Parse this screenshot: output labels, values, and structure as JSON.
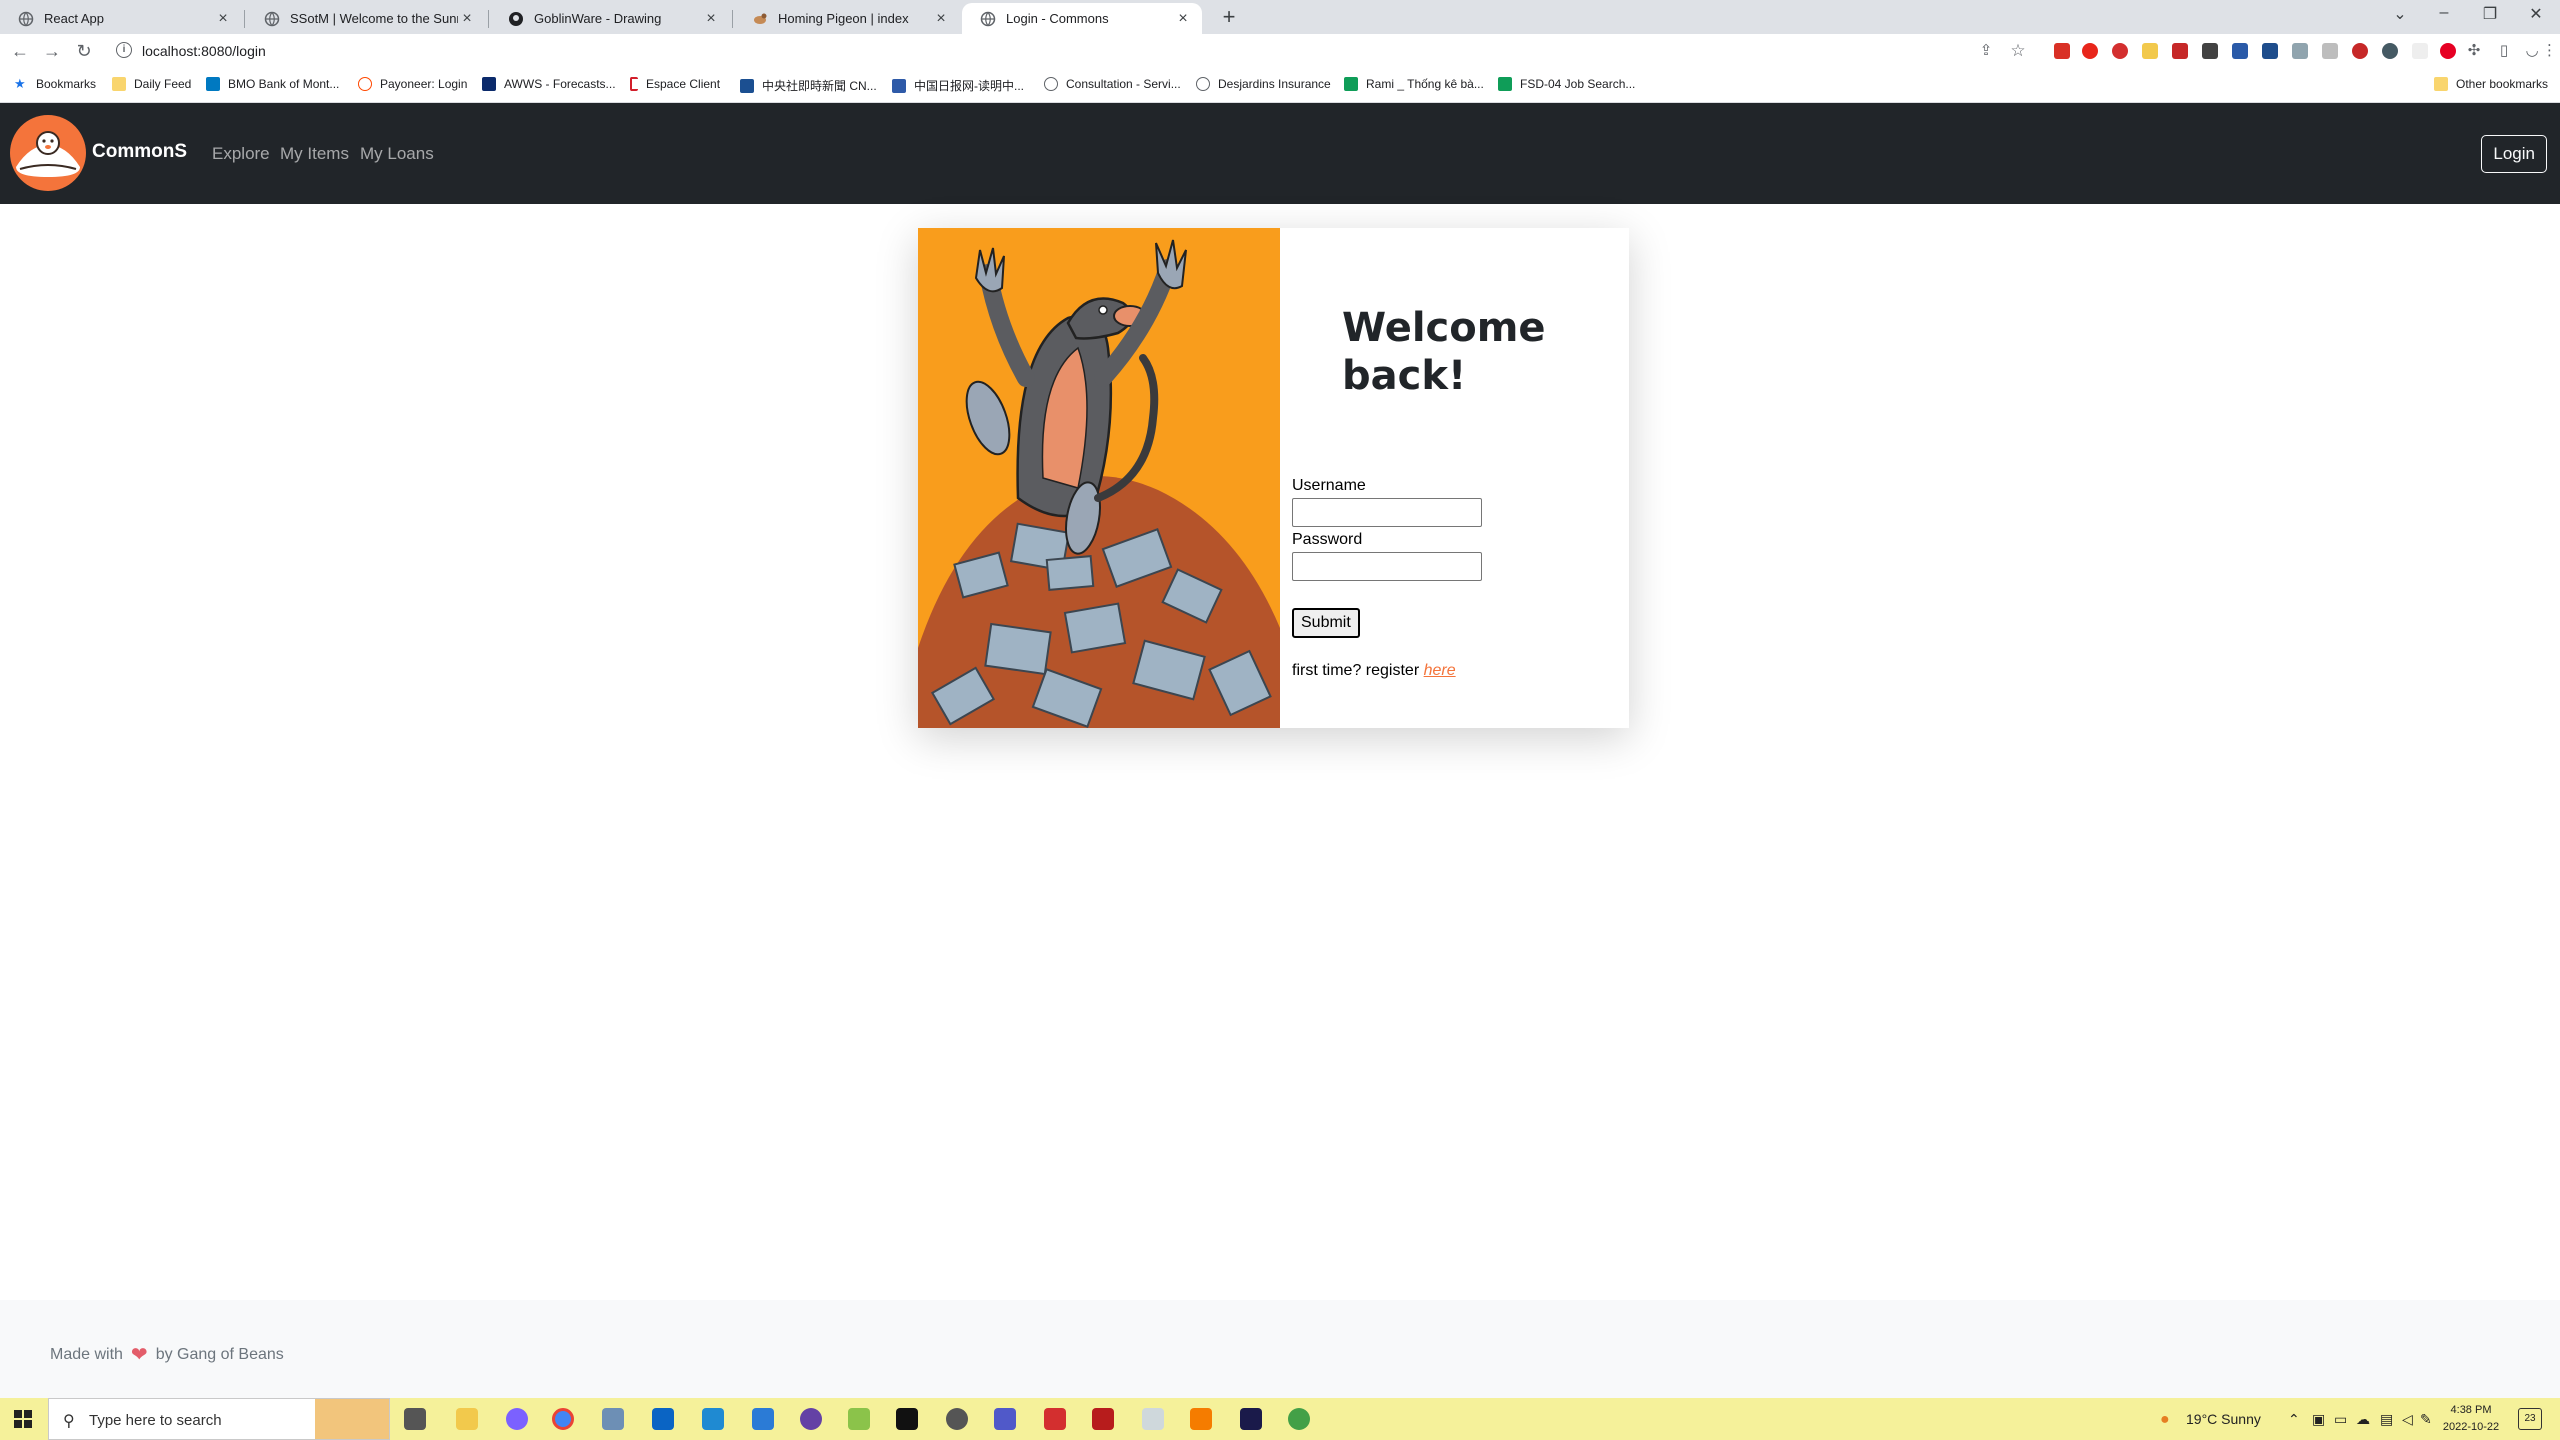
{
  "browser": {
    "tabs": [
      {
        "title": "React App",
        "active": false
      },
      {
        "title": "SSotM | Welcome to the Sunny Si",
        "active": false
      },
      {
        "title": "GoblinWare - Drawing",
        "active": false
      },
      {
        "title": "Homing Pigeon | index",
        "active": false
      },
      {
        "title": "Login - Commons",
        "active": true
      }
    ],
    "new_tab": "+",
    "url": "localhost:8080/login",
    "bookmarks": [
      {
        "label": "Bookmarks",
        "icon": "star-icon",
        "color": "#1a73e8"
      },
      {
        "label": "Daily Feed",
        "icon": "folder-icon",
        "color": "#f9d56e"
      },
      {
        "label": "BMO Bank of Mont...",
        "icon": "bank-icon",
        "color": "#0079c1"
      },
      {
        "label": "Payoneer: Login",
        "icon": "circle-icon",
        "color": "#ff4800"
      },
      {
        "label": "AWWS - Forecasts...",
        "icon": "plane-icon",
        "color": "#0b2a6b"
      },
      {
        "label": "Espace Client",
        "icon": "bracket-icon",
        "color": "#d21f2b"
      },
      {
        "label": "中央社即時新聞 CN...",
        "icon": "news-icon",
        "color": "#1b4f91"
      },
      {
        "label": "中国日报网-读明中...",
        "icon": "news-icon",
        "color": "#2e5aa8"
      },
      {
        "label": "Consultation - Servi...",
        "icon": "globe-icon",
        "color": "#5f6368"
      },
      {
        "label": "Desjardins Insurance",
        "icon": "globe-icon",
        "color": "#5f6368"
      },
      {
        "label": "Rami _ Thống kê bà...",
        "icon": "sheet-icon",
        "color": "#0f9d58"
      },
      {
        "label": "FSD-04 Job Search...",
        "icon": "sheet-icon",
        "color": "#0f9d58"
      }
    ],
    "other_bookmarks": "Other bookmarks"
  },
  "app": {
    "brand": "CommonS",
    "nav": [
      "Explore",
      "My Items",
      "My Loans"
    ],
    "login_button": "Login"
  },
  "login": {
    "heading": "Welcome back!",
    "username_label": "Username",
    "password_label": "Password",
    "submit": "Submit",
    "register_text": "first time? register",
    "register_link": "here"
  },
  "footer": {
    "prefix": "Made with",
    "suffix": "by Gang of Beans"
  },
  "taskbar": {
    "search_placeholder": "Type here to search",
    "weather": "19°C  Sunny",
    "time": "4:38 PM",
    "date": "2022-10-22",
    "notifications": "23"
  },
  "colors": {
    "navbar": "#212529",
    "accent": "#f4743b",
    "art_bg": "#f99d1c",
    "taskbar": "#f5f19a"
  }
}
